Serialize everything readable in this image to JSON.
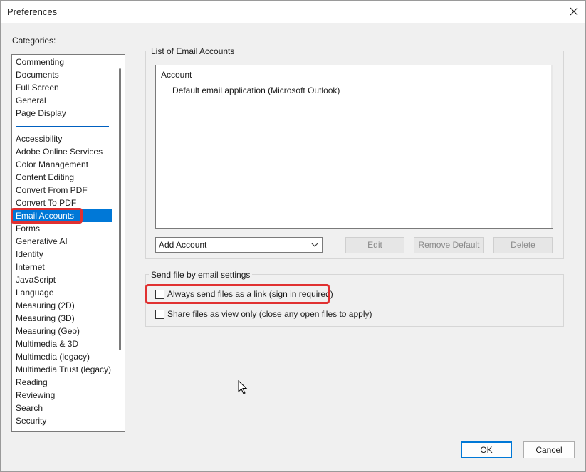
{
  "window": {
    "title": "Preferences"
  },
  "categories": {
    "label": "Categories:",
    "group_top": [
      "Commenting",
      "Documents",
      "Full Screen",
      "General",
      "Page Display"
    ],
    "group_bottom": [
      "Accessibility",
      "Adobe Online Services",
      "Color Management",
      "Content Editing",
      "Convert From PDF",
      "Convert To PDF",
      "Email Accounts",
      "Forms",
      "Generative AI",
      "Identity",
      "Internet",
      "JavaScript",
      "Language",
      "Measuring (2D)",
      "Measuring (3D)",
      "Measuring (Geo)",
      "Multimedia & 3D",
      "Multimedia (legacy)",
      "Multimedia Trust (legacy)",
      "Reading",
      "Reviewing",
      "Search",
      "Security"
    ],
    "selected": "Email Accounts"
  },
  "email_accounts": {
    "group_title": "List of Email Accounts",
    "column_header": "Account",
    "accounts": [
      "Default email application (Microsoft Outlook)"
    ],
    "add_account_label": "Add Account",
    "edit_label": "Edit",
    "remove_default_label": "Remove Default",
    "delete_label": "Delete"
  },
  "send_settings": {
    "group_title": "Send file by email settings",
    "option_link": "Always send files as a link (sign in required)",
    "option_view_only": "Share files as view only (close any open files to apply)"
  },
  "footer": {
    "ok_label": "OK",
    "cancel_label": "Cancel"
  },
  "colors": {
    "selection": "#0078d7",
    "highlight": "#e03131"
  },
  "icons": [
    "close-icon",
    "chevron-down-icon",
    "mouse-cursor-icon"
  ]
}
